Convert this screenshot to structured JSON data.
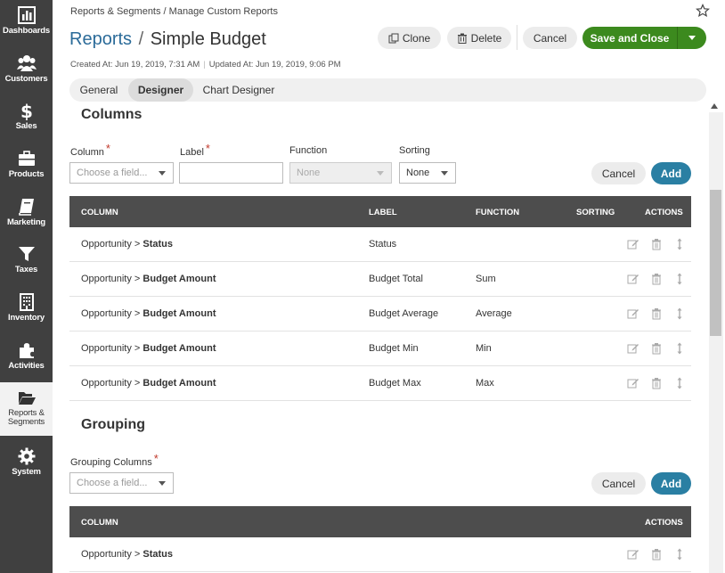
{
  "sidebar": {
    "items": [
      {
        "label": "Dashboards",
        "icon": "bar-chart-icon"
      },
      {
        "label": "Customers",
        "icon": "users-icon"
      },
      {
        "label": "Sales",
        "icon": "dollar-icon"
      },
      {
        "label": "Products",
        "icon": "briefcase-icon"
      },
      {
        "label": "Marketing",
        "icon": "book-icon"
      },
      {
        "label": "Taxes",
        "icon": "filter-icon"
      },
      {
        "label": "Inventory",
        "icon": "building-icon"
      },
      {
        "label": "Activities",
        "icon": "puzzle-icon"
      },
      {
        "label": "Reports & Segments",
        "icon": "folder-open-icon"
      },
      {
        "label": "System",
        "icon": "gear-icon"
      }
    ]
  },
  "header": {
    "breadcrumb": "Reports & Segments / Manage Custom Reports",
    "title_link": "Reports",
    "title_sep": "/",
    "title": "Simple Budget",
    "created": "Created At: Jun 19, 2019, 7:31 AM",
    "updated": "Updated At: Jun 19, 2019, 9:06 PM",
    "clone": "Clone",
    "delete": "Delete",
    "cancel": "Cancel",
    "save": "Save and Close"
  },
  "tabs": [
    {
      "label": "General"
    },
    {
      "label": "Designer"
    },
    {
      "label": "Chart Designer"
    }
  ],
  "columns_section": {
    "title": "Columns",
    "column_label": "Column",
    "column_placeholder": "Choose a field...",
    "label_label": "Label",
    "function_label": "Function",
    "function_value": "None",
    "sorting_label": "Sorting",
    "sorting_value": "None",
    "cancel": "Cancel",
    "add": "Add",
    "headers": {
      "column": "COLUMN",
      "label": "LABEL",
      "function": "FUNCTION",
      "sorting": "SORTING",
      "actions": "ACTIONS"
    },
    "rows": [
      {
        "prefix": "Opportunity > ",
        "field": "Status",
        "label": "Status",
        "function": ""
      },
      {
        "prefix": "Opportunity > ",
        "field": "Budget Amount",
        "label": "Budget Total",
        "function": "Sum"
      },
      {
        "prefix": "Opportunity > ",
        "field": "Budget Amount",
        "label": "Budget Average",
        "function": "Average"
      },
      {
        "prefix": "Opportunity > ",
        "field": "Budget Amount",
        "label": "Budget Min",
        "function": "Min"
      },
      {
        "prefix": "Opportunity > ",
        "field": "Budget Amount",
        "label": "Budget Max",
        "function": "Max"
      }
    ]
  },
  "grouping_section": {
    "title": "Grouping",
    "columns_label": "Grouping Columns",
    "placeholder": "Choose a field...",
    "cancel": "Cancel",
    "add": "Add",
    "headers": {
      "column": "COLUMN",
      "actions": "ACTIONS"
    },
    "rows": [
      {
        "prefix": "Opportunity > ",
        "field": "Status"
      }
    ]
  }
}
